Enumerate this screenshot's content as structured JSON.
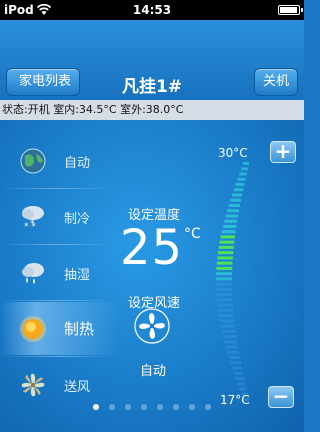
{
  "status_bar": {
    "carrier": "iPod",
    "time": "14:53"
  },
  "navbar": {
    "back_label": "家电列表",
    "title": "凡挂1#",
    "power_label": "关机"
  },
  "status_line": "状态:开机 室内:34.5°C 室外:38.0°C",
  "modes": [
    {
      "label": "自动",
      "icon": "globe-icon",
      "active": false
    },
    {
      "label": "制冷",
      "icon": "snow-cloud-icon",
      "active": false
    },
    {
      "label": "抽湿",
      "icon": "cloud-drop-icon",
      "active": false
    },
    {
      "label": "制热",
      "icon": "sun-icon",
      "active": true
    },
    {
      "label": "送风",
      "icon": "fan-icon",
      "active": false
    }
  ],
  "temperature": {
    "set_label": "设定温度",
    "value": "25",
    "unit": "°C",
    "max_label": "30°C",
    "min_label": "17°C",
    "current": 25,
    "min": 17,
    "max": 30
  },
  "fan": {
    "set_label": "设定风速",
    "speed": "自动"
  },
  "buttons": {
    "plus": "+",
    "minus": "−"
  },
  "pager": {
    "count": 8,
    "active_index": 0
  },
  "colors": {
    "accent": "#1a78c4",
    "active_arc": "#4de05a",
    "arc_base": "#2ec4d8"
  }
}
